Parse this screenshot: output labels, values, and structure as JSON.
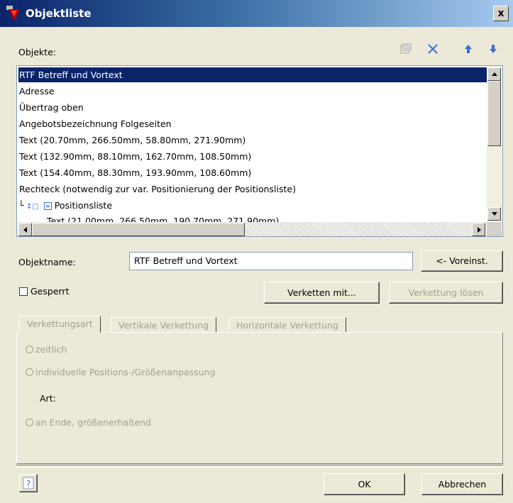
{
  "window": {
    "title": "Objektliste",
    "close_label": "x"
  },
  "objects_label": "Objekte:",
  "toolbar": {
    "properties_icon": "properties-icon",
    "delete_icon": "delete-x-icon",
    "up_icon": "arrow-up-icon",
    "down_icon": "arrow-down-icon"
  },
  "list": {
    "items": [
      "RTF Betreff und Vortext",
      "Adresse",
      "Übertrag oben",
      "Angebotsbezeichnung Folgeseiten",
      "Text (20.70mm, 266.50mm, 58.80mm, 271.90mm)",
      "Text (132.90mm, 88.10mm, 162.70mm, 108.50mm)",
      "Text (154.40mm, 88.30mm, 193.90mm, 108.60mm)",
      "Rechteck (notwendig zur var. Positionierung der Positionsliste)",
      "Positionsliste",
      "Text (21.00mm, 266.50mm, 190.70mm, 271.90mm)"
    ],
    "selected": 0
  },
  "objektname": {
    "label": "Objektname:",
    "value": "RTF Betreff und Vortext",
    "default_button": "<- Voreinst."
  },
  "gesperrt_label": "Gesperrt",
  "buttons": {
    "verketten": "Verketten mit...",
    "verkettung_loesen": "Verkettung lösen",
    "ok": "OK",
    "abbrechen": "Abbrechen"
  },
  "tabs": [
    "Verkettungsart",
    "Vertikale Verkettung",
    "Horizontale Verkettung"
  ],
  "options": {
    "zeitlich": "zeitlich",
    "individuell": "individuelle Positions-/Größenanpassung",
    "art_label": "Art:",
    "an_ende": "an Ende, größenerhaltend"
  },
  "help_icon": "help-question-icon",
  "colors": {
    "selection": "#0a246a",
    "disabled_text": "#a09f95",
    "dialog_bg": "#ece9d8",
    "title_start": "#0a246a"
  }
}
